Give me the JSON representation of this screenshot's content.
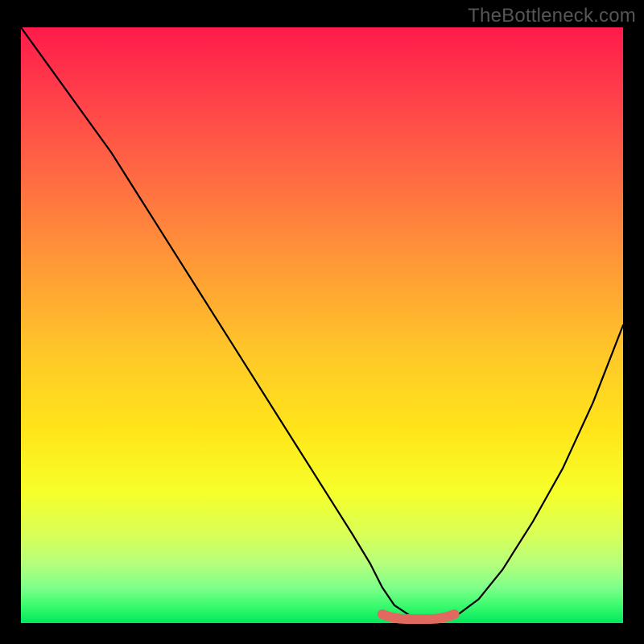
{
  "watermark": "TheBottleneck.com",
  "chart_data": {
    "type": "line",
    "title": "",
    "xlabel": "",
    "ylabel": "",
    "xlim": [
      0,
      100
    ],
    "ylim": [
      0,
      100
    ],
    "x": [
      0,
      5,
      10,
      15,
      20,
      25,
      30,
      35,
      40,
      45,
      50,
      55,
      58,
      60,
      62,
      65,
      67,
      69,
      72,
      76,
      80,
      85,
      90,
      95,
      100
    ],
    "values": [
      100,
      93,
      86,
      79,
      71,
      63,
      55,
      47,
      39,
      31,
      23,
      15,
      10,
      6,
      3,
      1,
      0,
      0,
      1,
      4,
      9,
      17,
      26,
      37,
      50
    ],
    "optimal_range_x": [
      60,
      72
    ],
    "colors": {
      "curve": "#000000",
      "marker": "#e06a60",
      "gradient_top": "#ff1a4b",
      "gradient_bottom": "#00e75c"
    }
  }
}
